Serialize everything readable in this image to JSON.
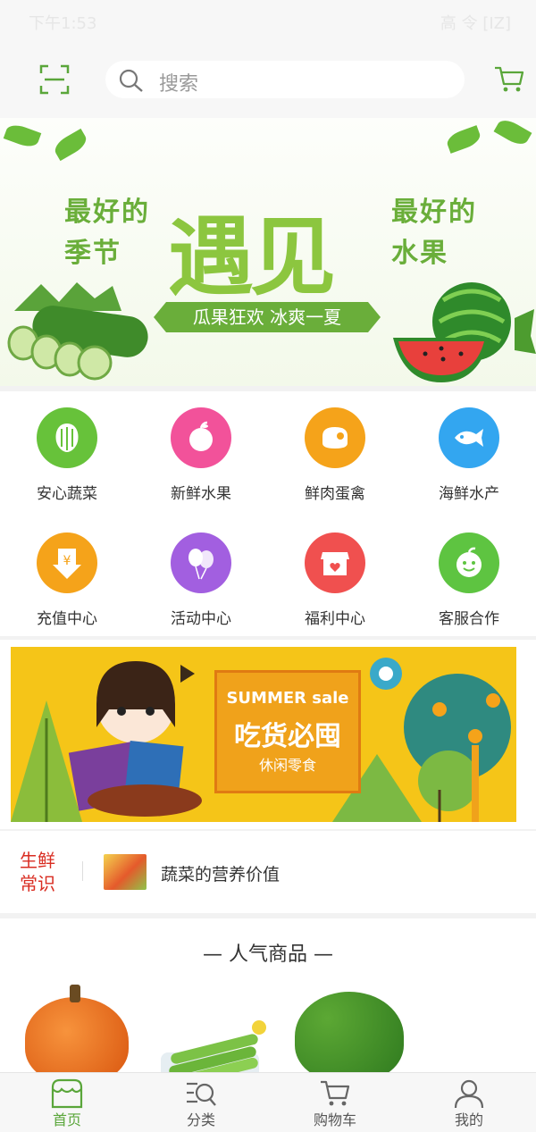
{
  "status_bar": {
    "time": "下午1:53",
    "right": "高 令 [IZ]"
  },
  "search": {
    "placeholder": "搜索"
  },
  "banner": {
    "left_line1": "最好的",
    "left_line2": "季节",
    "big_text": "遇见",
    "right_line1": "最好的",
    "right_line2": "水果",
    "ribbon": "瓜果狂欢 冰爽一夏"
  },
  "categories": [
    {
      "label": "安心蔬菜",
      "color": "#67c23a",
      "icon": "vegetable-icon"
    },
    {
      "label": "新鲜水果",
      "color": "#f2529a",
      "icon": "fruit-icon"
    },
    {
      "label": "鲜肉蛋禽",
      "color": "#f5a31a",
      "icon": "meat-icon"
    },
    {
      "label": "海鲜水产",
      "color": "#33a6f0",
      "icon": "fish-icon"
    },
    {
      "label": "充值中心",
      "color": "#f5a31a",
      "icon": "recharge-icon"
    },
    {
      "label": "活动中心",
      "color": "#a25fe0",
      "icon": "balloon-icon"
    },
    {
      "label": "福利中心",
      "color": "#f0504f",
      "icon": "shop-icon"
    },
    {
      "label": "客服合作",
      "color": "#5ec441",
      "icon": "service-icon"
    }
  ],
  "promo": {
    "line1": "SUMMER sale",
    "line2": "吃货必囤",
    "line3": "休闲零食"
  },
  "news": {
    "tag_line1": "生鲜",
    "tag_line2": "常识",
    "text": "蔬菜的营养价值"
  },
  "popular": {
    "title": "— 人气商品 —"
  },
  "tabs": [
    {
      "label": "首页",
      "icon": "home-icon",
      "active": true
    },
    {
      "label": "分类",
      "icon": "category-icon",
      "active": false
    },
    {
      "label": "购物车",
      "icon": "cart-icon",
      "active": false
    },
    {
      "label": "我的",
      "icon": "user-icon",
      "active": false
    }
  ],
  "colors": {
    "accent": "#5aa63a",
    "news_tag": "#d92d22"
  }
}
